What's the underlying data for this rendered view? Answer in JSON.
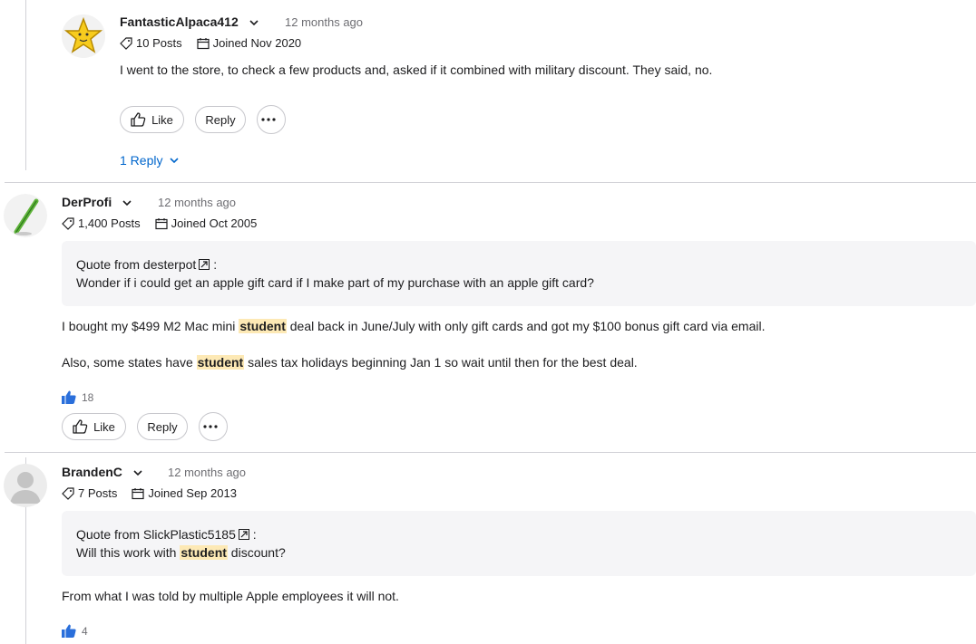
{
  "posts": [
    {
      "author": "FantasticAlpaca412",
      "time": "12 months ago",
      "posts_count": "10 Posts",
      "joined": "Joined Nov 2020",
      "body": "I went to the store, to check a few products and, asked if it combined with military discount. They said, no.",
      "like_label": "Like",
      "reply_label": "Reply",
      "replies_label": "1 Reply",
      "avatar_icon": "star-avatar"
    },
    {
      "author": "DerProfi",
      "time": "12 months ago",
      "posts_count": "1,400 Posts",
      "joined": "Joined Oct 2005",
      "quote_prefix": "Quote from desterpot",
      "quote_suffix": ":",
      "quote_text": "Wonder if i could get an apple gift card if I make part of my purchase with an apple gift card?",
      "body1_pre": "I bought my $499 M2 Mac mini ",
      "body1_hl": "student",
      "body1_post": " deal back in June/July with only gift cards and got my $100 bonus gift card via email.",
      "body2_pre": "Also, some states have ",
      "body2_hl": "student",
      "body2_post": " sales tax holidays beginning Jan 1 so wait until then for the best deal.",
      "likes": "18",
      "like_label": "Like",
      "reply_label": "Reply",
      "avatar_icon": "pen-avatar"
    },
    {
      "author": "BrandenC",
      "time": "12 months ago",
      "posts_count": "7 Posts",
      "joined": "Joined Sep 2013",
      "quote_prefix": "Quote from SlickPlastic5185",
      "quote_suffix": ":",
      "quote_pre": "Will this work with ",
      "quote_hl": "student",
      "quote_post": " discount?",
      "body": "From what I was told by multiple Apple employees it will not.",
      "likes": "4",
      "avatar_icon": "default-person-avatar"
    }
  ],
  "colors": {
    "link": "#0066cc",
    "highlight": "#fde9b5",
    "quote_bg": "#f5f5f7",
    "divider": "#d2d2d7"
  }
}
